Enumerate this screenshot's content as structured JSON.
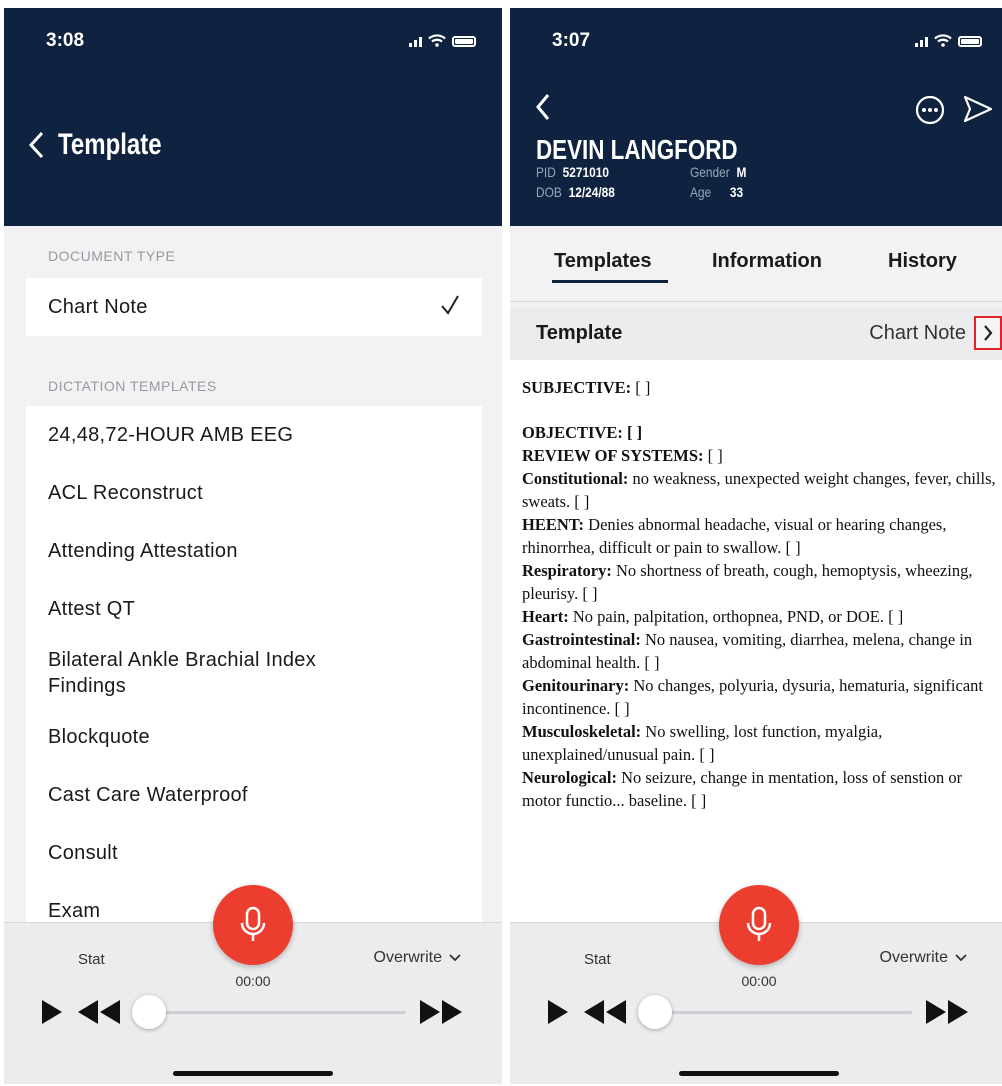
{
  "left": {
    "status_time": "3:08",
    "title": "Template",
    "document_type_header": "DOCUMENT TYPE",
    "document_type": "Chart Note",
    "dictation_header": "DICTATION TEMPLATES",
    "templates": [
      "24,48,72-HOUR AMB EEG",
      "ACL Reconstruct",
      "Attending Attestation",
      "Attest QT",
      "Bilateral Ankle Brachial Index Findings",
      "Blockquote",
      "Cast Care Waterproof",
      "Consult",
      "Exam"
    ],
    "player": {
      "stat": "Stat",
      "timer": "00:00",
      "mode": "Overwrite"
    }
  },
  "right": {
    "status_time": "3:07",
    "patient": {
      "name": "DEVIN LANGFORD",
      "pid_label": "PID",
      "pid": "5271010",
      "dob_label": "DOB",
      "dob": "12/24/88",
      "gender_label": "Gender",
      "gender": "M",
      "age_label": "Age",
      "age": "33"
    },
    "tabs": [
      "Templates",
      "Information",
      "History"
    ],
    "template_label": "Template",
    "template_value": "Chart Note",
    "document": {
      "subjective_h": "SUBJECTIVE:",
      "subjective_v": "[ ]",
      "objective_h": "OBJECTIVE:",
      "objective_v": "[ ]",
      "ros_h": "REVIEW OF SYSTEMS:",
      "ros_v": "[ ]",
      "sections": [
        {
          "h": "Constitutional:",
          "t": "no weakness, unexpected weight changes, fever, chills, sweats. [ ]"
        },
        {
          "h": "HEENT:",
          "t": "Denies abnormal headache, visual or hearing changes, rhinorrhea, difficult or pain to swallow. [ ]"
        },
        {
          "h": "Respiratory:",
          "t": "No shortness of breath, cough, hemoptysis, wheezing, pleurisy. [ ]"
        },
        {
          "h": "Heart:",
          "t": "No pain, palpitation, orthopnea, PND, or DOE. [ ]"
        },
        {
          "h": "Gastrointestinal:",
          "t": "No nausea, vomiting, diarrhea, melena, change in abdominal health. [ ]"
        },
        {
          "h": "Genitourinary:",
          "t": "No changes, polyuria, dysuria, hematuria, significant incontinence. [ ]"
        },
        {
          "h": "Musculoskeletal:",
          "t": "No swelling, lost function, myalgia, unexplained/unusual pain. [ ]"
        },
        {
          "h": "Neurological:",
          "t": "No seizure, change in mentation, loss of senstion or motor functio... baseline. [ ]"
        }
      ]
    },
    "player": {
      "stat": "Stat",
      "timer": "00:00",
      "mode": "Overwrite"
    }
  }
}
